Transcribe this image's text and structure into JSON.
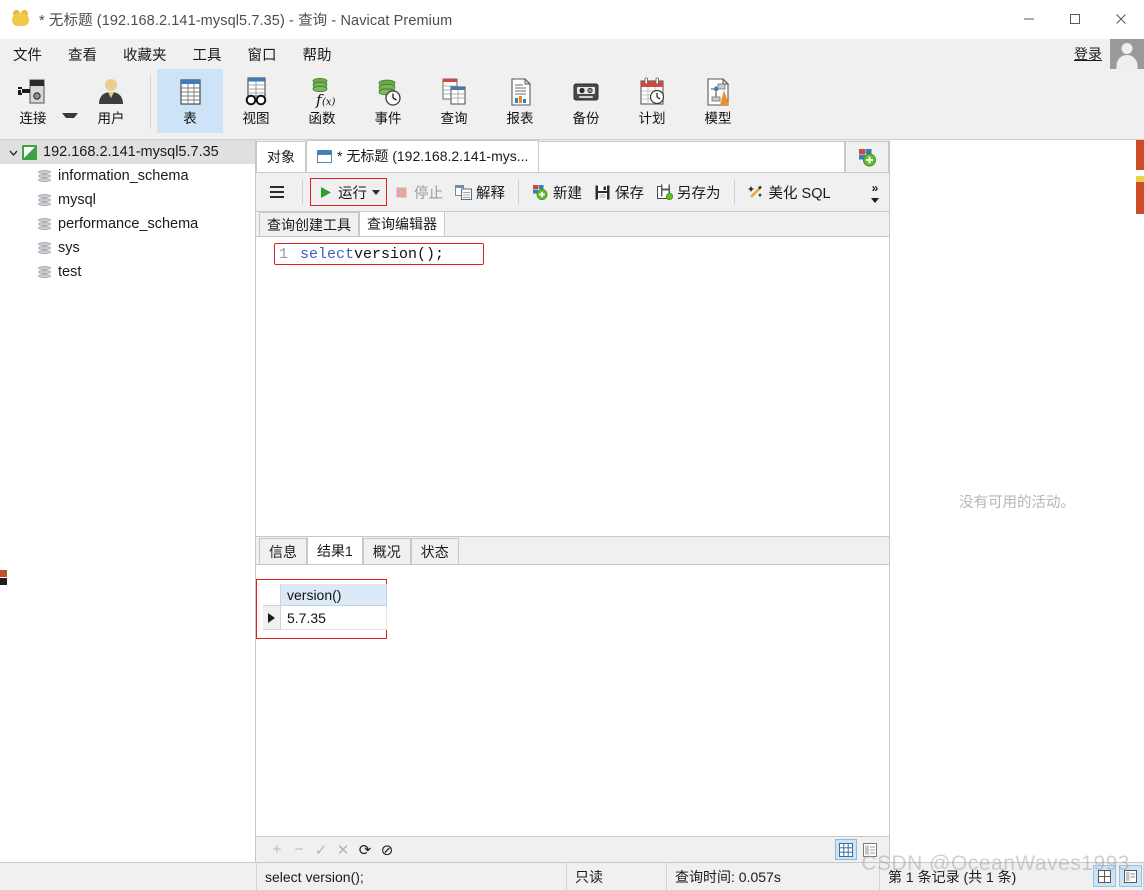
{
  "window": {
    "title": "* 无标题 (192.168.2.141-mysql5.7.35) - 查询 - Navicat Premium",
    "app_icon": "navicat-logo-icon",
    "minimize": "minimize-icon",
    "maximize": "maximize-icon",
    "close": "close-icon"
  },
  "menu": {
    "items": [
      {
        "label": "文件"
      },
      {
        "label": "查看"
      },
      {
        "label": "收藏夹"
      },
      {
        "label": "工具"
      },
      {
        "label": "窗口"
      },
      {
        "label": "帮助"
      }
    ],
    "login_label": "登录"
  },
  "toolbar": {
    "items": [
      {
        "label": "连接",
        "icon": "connection-icon",
        "selected": false,
        "has_caret": true
      },
      {
        "label": "用户",
        "icon": "user-icon",
        "selected": false,
        "has_caret": false
      },
      {
        "label": "表",
        "icon": "table-icon",
        "selected": true,
        "has_caret": false
      },
      {
        "label": "视图",
        "icon": "view-icon",
        "selected": false,
        "has_caret": false
      },
      {
        "label": "函数",
        "icon": "function-icon",
        "selected": false,
        "has_caret": false
      },
      {
        "label": "事件",
        "icon": "event-icon",
        "selected": false,
        "has_caret": false
      },
      {
        "label": "查询",
        "icon": "query-icon",
        "selected": false,
        "has_caret": false
      },
      {
        "label": "报表",
        "icon": "report-icon",
        "selected": false,
        "has_caret": false
      },
      {
        "label": "备份",
        "icon": "backup-icon",
        "selected": false,
        "has_caret": false
      },
      {
        "label": "计划",
        "icon": "schedule-icon",
        "selected": false,
        "has_caret": false
      },
      {
        "label": "模型",
        "icon": "model-icon",
        "selected": false,
        "has_caret": false
      }
    ]
  },
  "sidebar": {
    "connection": {
      "label": "192.168.2.141-mysql5.7.35",
      "expanded": true
    },
    "databases": [
      {
        "label": "information_schema"
      },
      {
        "label": "mysql"
      },
      {
        "label": "performance_schema"
      },
      {
        "label": "sys"
      },
      {
        "label": "test"
      }
    ]
  },
  "doc_tabs": {
    "object_tab": "对象",
    "query_tab": "* 无标题 (192.168.2.141-mys...",
    "new_tab_icon": "new-tab-icon"
  },
  "query_toolbar": {
    "menu_icon": "hamburger-icon",
    "run": "运行",
    "stop": "停止",
    "explain": "解释",
    "new": "新建",
    "save": "保存",
    "save_as": "另存为",
    "beautify": "美化 SQL",
    "overflow_icon": "chevron-double-right-icon"
  },
  "editor_tabs": [
    {
      "label": "查询创建工具",
      "active": false
    },
    {
      "label": "查询编辑器",
      "active": true
    }
  ],
  "editor": {
    "line_number": "1",
    "keyword": "select",
    "rest": " version();"
  },
  "result_tabs": [
    {
      "label": "信息",
      "active": false
    },
    {
      "label": "结果1",
      "active": true
    },
    {
      "label": "概况",
      "active": false
    },
    {
      "label": "状态",
      "active": false
    }
  ],
  "result_grid": {
    "columns": [
      "version()"
    ],
    "rows": [
      [
        "5.7.35"
      ]
    ],
    "current_row_marker": "row-pointer-icon"
  },
  "grid_footer": {
    "buttons": [
      {
        "icon": "add-record-icon",
        "glyph": "+",
        "enabled": false
      },
      {
        "icon": "remove-record-icon",
        "glyph": "−",
        "enabled": false
      },
      {
        "icon": "apply-change-icon",
        "glyph": "✓",
        "enabled": false
      },
      {
        "icon": "cancel-change-icon",
        "glyph": "✕",
        "enabled": false
      },
      {
        "icon": "refresh-icon",
        "glyph": "⟳",
        "enabled": true
      },
      {
        "icon": "stop-loading-icon",
        "glyph": "⊘",
        "enabled": true
      }
    ],
    "view_grid_icon": "grid-view-icon",
    "view_form_icon": "form-view-icon"
  },
  "right_panel": {
    "empty_text": "没有可用的活动。"
  },
  "statusbar": {
    "sql": "select version();",
    "readonly": "只读",
    "query_time": "查询时间: 0.057s",
    "record_info": "第 1 条记录 (共 1 条)",
    "icon_1": "grid-layout-icon",
    "icon_2": "form-layout-icon"
  },
  "watermark": "CSDN @OceanWaves1993",
  "colors": {
    "accent_blue": "#cde3f7",
    "highlight_red": "#e02020",
    "run_green": "#2f9e2f",
    "db_green": "#3fa046",
    "keyword_blue": "#3b5fc0",
    "chrome_gray": "#f0f0f0"
  }
}
